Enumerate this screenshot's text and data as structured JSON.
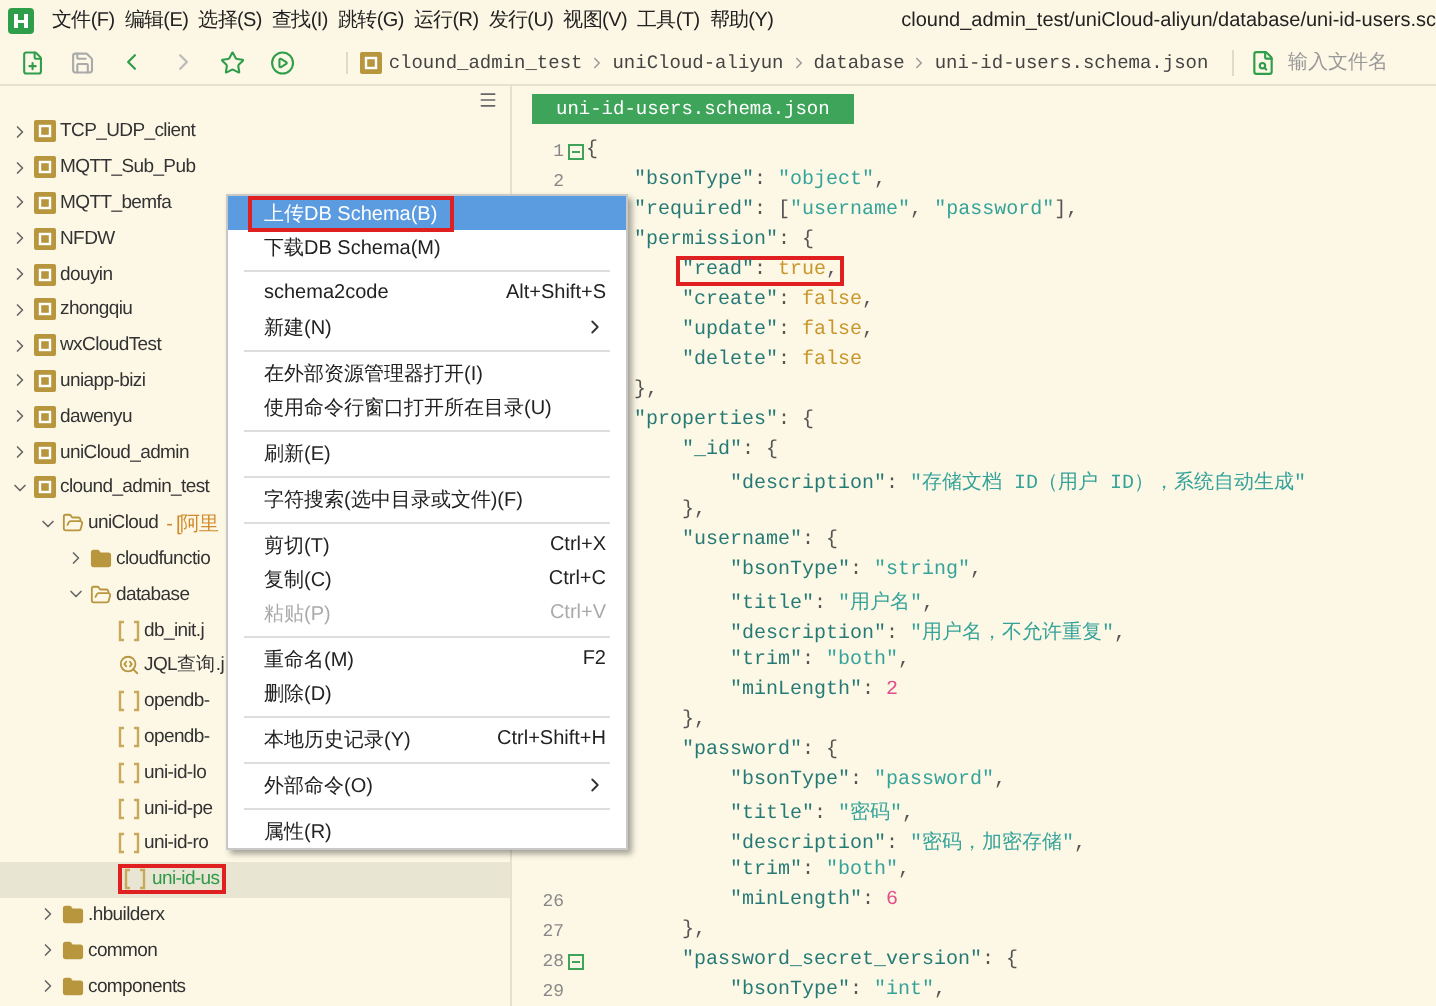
{
  "menubar": [
    "文件(F)",
    "编辑(E)",
    "选择(S)",
    "查找(I)",
    "跳转(G)",
    "运行(R)",
    "发行(U)",
    "视图(V)",
    "工具(T)",
    "帮助(Y)"
  ],
  "window": {
    "title": "clound_admin_test/uniCloud-aliyun/database/uni-id-users.sc"
  },
  "breadcrumb": [
    "clound_admin_test",
    "uniCloud-aliyun",
    "database",
    "uni-id-users.schema.json"
  ],
  "file_search": {
    "placeholder": "输入文件名"
  },
  "tree": [
    {
      "name": "TCP_UDP_client",
      "kind": "project",
      "expanded": false,
      "selected": false,
      "boxed": false
    },
    {
      "name": "MQTT_Sub_Pub",
      "kind": "project",
      "expanded": false,
      "selected": false,
      "boxed": false
    },
    {
      "name": "MQTT_bemfa",
      "kind": "project",
      "expanded": false,
      "selected": false,
      "boxed": false
    },
    {
      "name": "NFDW",
      "kind": "project",
      "expanded": false,
      "selected": false,
      "boxed": false
    },
    {
      "name": "douyin",
      "kind": "project",
      "expanded": false,
      "selected": false,
      "boxed": false
    },
    {
      "name": "zhongqiu",
      "kind": "project",
      "expanded": false,
      "selected": false,
      "boxed": false
    },
    {
      "name": "wxCloudTest",
      "kind": "project",
      "expanded": false,
      "selected": false,
      "boxed": false
    },
    {
      "name": "uniapp-bizi",
      "kind": "project",
      "expanded": false,
      "selected": false,
      "boxed": false
    },
    {
      "name": "dawenyu",
      "kind": "project",
      "expanded": false,
      "selected": false,
      "boxed": false
    },
    {
      "name": "uniCloud_admin",
      "kind": "project",
      "expanded": false,
      "selected": false,
      "boxed": false
    },
    {
      "name": "clound_admin_test",
      "kind": "project",
      "expanded": true,
      "selected": false,
      "boxed": false,
      "children": [
        {
          "name": "uniCloud",
          "tag": "- [阿里",
          "kind": "folder",
          "expanded": true,
          "selected": false,
          "boxed": false,
          "children": [
            {
              "name": "cloudfunctio",
              "kind": "folder",
              "expanded": false,
              "selected": false,
              "boxed": false
            },
            {
              "name": "database",
              "kind": "folder",
              "expanded": true,
              "selected": false,
              "boxed": false,
              "children": [
                {
                  "name": "db_init.j",
                  "kind": "file",
                  "selected": false,
                  "boxed": false
                },
                {
                  "name": "JQL查询.j",
                  "kind": "query",
                  "selected": false,
                  "boxed": false
                },
                {
                  "name": "opendb-",
                  "kind": "file",
                  "selected": false,
                  "boxed": false
                },
                {
                  "name": "opendb-",
                  "kind": "file",
                  "selected": false,
                  "boxed": false
                },
                {
                  "name": "uni-id-lo",
                  "kind": "file",
                  "selected": false,
                  "boxed": false
                },
                {
                  "name": "uni-id-pe",
                  "kind": "file",
                  "selected": false,
                  "boxed": false
                },
                {
                  "name": "uni-id-ro",
                  "kind": "file",
                  "selected": false,
                  "boxed": false
                },
                {
                  "name": "uni-id-us",
                  "kind": "file",
                  "selected": true,
                  "boxed": true
                }
              ]
            }
          ]
        },
        {
          "name": ".hbuilderx",
          "kind": "folder",
          "expanded": false,
          "selected": false,
          "boxed": false
        },
        {
          "name": "common",
          "kind": "folder",
          "expanded": false,
          "selected": false,
          "boxed": false
        },
        {
          "name": "components",
          "kind": "folder",
          "expanded": false,
          "selected": false,
          "boxed": false
        }
      ]
    }
  ],
  "editor_tab": {
    "label": "uni-id-users.schema.json",
    "selected": true
  },
  "code_lines": [
    {
      "number": "1",
      "fold": true,
      "boxed": false,
      "tokens": [
        {
          "kind": "punct",
          "text": "{"
        }
      ]
    },
    {
      "number": "2",
      "fold": false,
      "boxed": false,
      "tokens": [
        {
          "kind": "key",
          "text": "\"bsonType\""
        },
        {
          "kind": "punct",
          "text": ": "
        },
        {
          "kind": "string",
          "text": "\"object\""
        },
        {
          "kind": "punct",
          "text": ","
        }
      ]
    },
    {
      "fold": false,
      "boxed": false,
      "tokens": [
        {
          "kind": "key",
          "text": "\"required\""
        },
        {
          "kind": "punct",
          "text": ": ["
        },
        {
          "kind": "string",
          "text": "\"username\""
        },
        {
          "kind": "punct",
          "text": ", "
        },
        {
          "kind": "string",
          "text": "\"password\""
        },
        {
          "kind": "punct",
          "text": "],"
        }
      ]
    },
    {
      "fold": false,
      "boxed": false,
      "tokens": [
        {
          "kind": "key",
          "text": "\"permission\""
        },
        {
          "kind": "punct",
          "text": ": {"
        }
      ]
    },
    {
      "fold": false,
      "boxed": true,
      "tokens": [
        {
          "kind": "key",
          "text": "\"read\""
        },
        {
          "kind": "punct",
          "text": ": "
        },
        {
          "kind": "bool",
          "text": "true"
        },
        {
          "kind": "punct",
          "text": ","
        }
      ]
    },
    {
      "fold": false,
      "boxed": false,
      "tokens": [
        {
          "kind": "key",
          "text": "\"create\""
        },
        {
          "kind": "punct",
          "text": ": "
        },
        {
          "kind": "bool",
          "text": "false"
        },
        {
          "kind": "punct",
          "text": ","
        }
      ]
    },
    {
      "fold": false,
      "boxed": false,
      "tokens": [
        {
          "kind": "key",
          "text": "\"update\""
        },
        {
          "kind": "punct",
          "text": ": "
        },
        {
          "kind": "bool",
          "text": "false"
        },
        {
          "kind": "punct",
          "text": ","
        }
      ]
    },
    {
      "fold": false,
      "boxed": false,
      "tokens": [
        {
          "kind": "key",
          "text": "\"delete\""
        },
        {
          "kind": "punct",
          "text": ": "
        },
        {
          "kind": "bool",
          "text": "false"
        }
      ]
    },
    {
      "fold": false,
      "boxed": false,
      "tokens": [
        {
          "kind": "punct",
          "text": "},"
        }
      ]
    },
    {
      "fold": false,
      "boxed": false,
      "tokens": [
        {
          "kind": "key",
          "text": "\"properties\""
        },
        {
          "kind": "punct",
          "text": ": {"
        }
      ]
    },
    {
      "fold": false,
      "boxed": false,
      "tokens": [
        {
          "kind": "key",
          "text": "\"_id\""
        },
        {
          "kind": "punct",
          "text": ": {"
        }
      ]
    },
    {
      "fold": false,
      "boxed": false,
      "tokens": [
        {
          "kind": "key",
          "text": "\"description\""
        },
        {
          "kind": "punct",
          "text": ": "
        },
        {
          "kind": "string",
          "text": "\"存储文档 ID（用户 ID），系统自动生成\""
        }
      ]
    },
    {
      "fold": false,
      "boxed": false,
      "tokens": [
        {
          "kind": "punct",
          "text": "},"
        }
      ]
    },
    {
      "fold": false,
      "boxed": false,
      "tokens": [
        {
          "kind": "key",
          "text": "\"username\""
        },
        {
          "kind": "punct",
          "text": ": {"
        }
      ]
    },
    {
      "fold": false,
      "boxed": false,
      "tokens": [
        {
          "kind": "key",
          "text": "\"bsonType\""
        },
        {
          "kind": "punct",
          "text": ": "
        },
        {
          "kind": "string",
          "text": "\"string\""
        },
        {
          "kind": "punct",
          "text": ","
        }
      ]
    },
    {
      "fold": false,
      "boxed": false,
      "tokens": [
        {
          "kind": "key",
          "text": "\"title\""
        },
        {
          "kind": "punct",
          "text": ": "
        },
        {
          "kind": "string",
          "text": "\"用户名\""
        },
        {
          "kind": "punct",
          "text": ","
        }
      ]
    },
    {
      "fold": false,
      "boxed": false,
      "tokens": [
        {
          "kind": "key",
          "text": "\"description\""
        },
        {
          "kind": "punct",
          "text": ": "
        },
        {
          "kind": "string",
          "text": "\"用户名，不允许重复\""
        },
        {
          "kind": "punct",
          "text": ","
        }
      ]
    },
    {
      "fold": false,
      "boxed": false,
      "tokens": [
        {
          "kind": "key",
          "text": "\"trim\""
        },
        {
          "kind": "punct",
          "text": ": "
        },
        {
          "kind": "string",
          "text": "\"both\""
        },
        {
          "kind": "punct",
          "text": ","
        }
      ]
    },
    {
      "fold": false,
      "boxed": false,
      "tokens": [
        {
          "kind": "key",
          "text": "\"minLength\""
        },
        {
          "kind": "punct",
          "text": ": "
        },
        {
          "kind": "number",
          "text": "2"
        }
      ]
    },
    {
      "fold": false,
      "boxed": false,
      "tokens": [
        {
          "kind": "punct",
          "text": "},"
        }
      ]
    },
    {
      "fold": false,
      "boxed": false,
      "tokens": [
        {
          "kind": "key",
          "text": "\"password\""
        },
        {
          "kind": "punct",
          "text": ": {"
        }
      ]
    },
    {
      "fold": false,
      "boxed": false,
      "tokens": [
        {
          "kind": "key",
          "text": "\"bsonType\""
        },
        {
          "kind": "punct",
          "text": ": "
        },
        {
          "kind": "string",
          "text": "\"password\""
        },
        {
          "kind": "punct",
          "text": ","
        }
      ]
    },
    {
      "fold": false,
      "boxed": false,
      "tokens": [
        {
          "kind": "key",
          "text": "\"title\""
        },
        {
          "kind": "punct",
          "text": ": "
        },
        {
          "kind": "string",
          "text": "\"密码\""
        },
        {
          "kind": "punct",
          "text": ","
        }
      ]
    },
    {
      "fold": false,
      "boxed": false,
      "tokens": [
        {
          "kind": "key",
          "text": "\"description\""
        },
        {
          "kind": "punct",
          "text": ": "
        },
        {
          "kind": "string",
          "text": "\"密码，加密存储\""
        },
        {
          "kind": "punct",
          "text": ","
        }
      ]
    },
    {
      "fold": false,
      "boxed": false,
      "tokens": [
        {
          "kind": "key",
          "text": "\"trim\""
        },
        {
          "kind": "punct",
          "text": ": "
        },
        {
          "kind": "string",
          "text": "\"both\""
        },
        {
          "kind": "punct",
          "text": ","
        }
      ]
    },
    {
      "number": "26",
      "fold": false,
      "boxed": false,
      "tokens": [
        {
          "kind": "key",
          "text": "\"minLength\""
        },
        {
          "kind": "punct",
          "text": ": "
        },
        {
          "kind": "number",
          "text": "6"
        }
      ]
    },
    {
      "number": "27",
      "fold": false,
      "boxed": false,
      "tokens": [
        {
          "kind": "punct",
          "text": "},"
        }
      ]
    },
    {
      "number": "28",
      "fold": true,
      "boxed": false,
      "tokens": [
        {
          "kind": "key",
          "text": "\"password_secret_version\""
        },
        {
          "kind": "punct",
          "text": ": {"
        }
      ]
    },
    {
      "number": "29",
      "fold": false,
      "boxed": false,
      "tokens": [
        {
          "kind": "key",
          "text": "\"bsonType\""
        },
        {
          "kind": "punct",
          "text": ": "
        },
        {
          "kind": "string",
          "text": "\"int\""
        },
        {
          "kind": "punct",
          "text": ","
        }
      ]
    }
  ],
  "context_menu": [
    {
      "kind": "item",
      "label": "上传DB Schema(B)",
      "selected": true,
      "boxed": true,
      "disabled": false
    },
    {
      "kind": "item",
      "label": "下载DB Schema(M)",
      "selected": false,
      "boxed": false,
      "disabled": false
    },
    {
      "kind": "separator"
    },
    {
      "kind": "item",
      "label": "schema2code",
      "shortcut": "Alt+Shift+S",
      "selected": false,
      "boxed": false,
      "disabled": false
    },
    {
      "kind": "submenu",
      "label": "新建(N)",
      "selected": false,
      "boxed": false,
      "disabled": false
    },
    {
      "kind": "separator"
    },
    {
      "kind": "item",
      "label": "在外部资源管理器打开(I)",
      "selected": false,
      "boxed": false,
      "disabled": false
    },
    {
      "kind": "item",
      "label": "使用命令行窗口打开所在目录(U)",
      "selected": false,
      "boxed": false,
      "disabled": false
    },
    {
      "kind": "separator"
    },
    {
      "kind": "item",
      "label": "刷新(E)",
      "selected": false,
      "boxed": false,
      "disabled": false
    },
    {
      "kind": "separator"
    },
    {
      "kind": "item",
      "label": "字符搜索(选中目录或文件)(F)",
      "selected": false,
      "boxed": false,
      "disabled": false
    },
    {
      "kind": "separator"
    },
    {
      "kind": "item",
      "label": "剪切(T)",
      "shortcut": "Ctrl+X",
      "selected": false,
      "boxed": false,
      "disabled": false
    },
    {
      "kind": "item",
      "label": "复制(C)",
      "shortcut": "Ctrl+C",
      "selected": false,
      "boxed": false,
      "disabled": false
    },
    {
      "kind": "item",
      "label": "粘贴(P)",
      "shortcut": "Ctrl+V",
      "selected": false,
      "boxed": false,
      "disabled": true
    },
    {
      "kind": "separator"
    },
    {
      "kind": "item",
      "label": "重命名(M)",
      "shortcut": "F2",
      "selected": false,
      "boxed": false,
      "disabled": false
    },
    {
      "kind": "item",
      "label": "删除(D)",
      "selected": false,
      "boxed": false,
      "disabled": false
    },
    {
      "kind": "separator"
    },
    {
      "kind": "item",
      "label": "本地历史记录(Y)",
      "shortcut": "Ctrl+Shift+H",
      "selected": false,
      "boxed": false,
      "disabled": false
    },
    {
      "kind": "separator"
    },
    {
      "kind": "submenu",
      "label": "外部命令(O)",
      "selected": false,
      "boxed": false,
      "disabled": false
    },
    {
      "kind": "separator"
    },
    {
      "kind": "item",
      "label": "属性(R)",
      "selected": false,
      "boxed": false,
      "disabled": false
    }
  ]
}
